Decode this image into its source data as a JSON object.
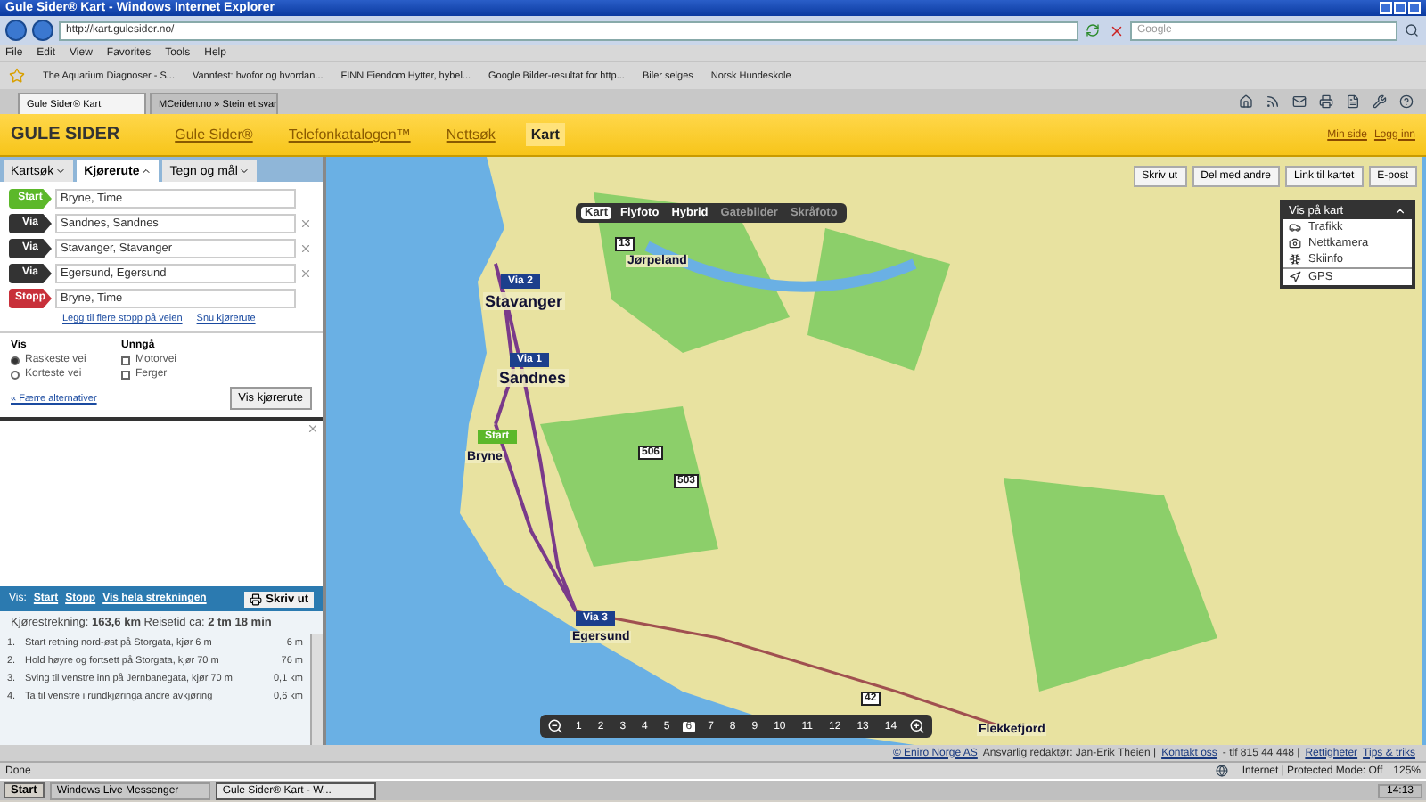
{
  "window": {
    "title": "Gule Sider® Kart - Windows Internet Explorer"
  },
  "address_bar": {
    "url": "http://kart.gulesider.no/",
    "search_placeholder": "Google"
  },
  "menu": [
    "File",
    "Edit",
    "View",
    "Favorites",
    "Tools",
    "Help"
  ],
  "favorites": [
    "The Aquarium Diagnoser - S...",
    "Vannfest: hvofor og hvordan...",
    "FINN Eiendom Hytter, hybel...",
    "Google Bilder-resultat for http...",
    "Biler selges",
    "Norsk Hundeskole"
  ],
  "browser_tabs": [
    {
      "label": "Gule Sider® Kart",
      "selected": true
    },
    {
      "label": "MCeiden.no » Stein et svar",
      "selected": false
    }
  ],
  "site_header": {
    "logo": "GULE SIDER",
    "nav": [
      {
        "label": "Gule Sider®",
        "selected": false
      },
      {
        "label": "Telefonkatalogen™",
        "selected": false
      },
      {
        "label": "Nettsøk",
        "selected": false
      },
      {
        "label": "Kart",
        "selected": true
      }
    ],
    "account": [
      "Min side",
      "Logg inn"
    ]
  },
  "panel_tabs": [
    {
      "label": "Kartsøk",
      "selected": false
    },
    {
      "label": "Kjørerute",
      "selected": true
    },
    {
      "label": "Tegn og mål",
      "selected": false
    }
  ],
  "route_points": [
    {
      "kind": "start",
      "tag": "Start",
      "value": "Bryne, Time"
    },
    {
      "kind": "via",
      "tag": "Via",
      "value": "Sandnes, Sandnes"
    },
    {
      "kind": "via",
      "tag": "Via",
      "value": "Stavanger, Stavanger"
    },
    {
      "kind": "via",
      "tag": "Via",
      "value": "Egersund, Egersund"
    },
    {
      "kind": "stop",
      "tag": "Stopp",
      "value": "Bryne, Time"
    }
  ],
  "route_links": [
    "Legg til flere stopp på veien",
    "Snu kjørerute"
  ],
  "options": {
    "show_title": "Vis",
    "show": [
      {
        "label": "Raskeste vei",
        "selected": true
      },
      {
        "label": "Korteste vei",
        "selected": false
      }
    ],
    "avoid_title": "Unngå",
    "avoid": [
      {
        "label": "Motorvei",
        "checked": false
      },
      {
        "label": "Ferger",
        "checked": false
      }
    ]
  },
  "fewer_link": "« Færre alternativer",
  "submit": "Vis kjørerute",
  "results_bar": {
    "label": "Vis:",
    "links": [
      "Start",
      "Stopp",
      "Vis hela strekningen"
    ],
    "print": "Skriv ut"
  },
  "summary": "Kjørestrekning: **163,6 km**  Reisetid ca: **2 tm 18 min**",
  "steps": [
    {
      "number": "1.",
      "text": "Start retning nord-øst på Storgata, kjør 6 m",
      "distance": "6 m"
    },
    {
      "number": "2.",
      "text": "Hold høyre og fortsett på Storgata, kjør 70 m",
      "distance": "76 m"
    },
    {
      "number": "3.",
      "text": "Sving til venstre inn på Jernbanegata, kjør 70 m",
      "distance": "0,1 km"
    },
    {
      "number": "4.",
      "text": "Ta til venstre i rundkjøringa andre avkjøring",
      "distance": "0,6 km"
    }
  ],
  "map_types": [
    {
      "label": "Kart",
      "selected": true,
      "disabled": false
    },
    {
      "label": "Flyfoto",
      "selected": false,
      "disabled": false
    },
    {
      "label": "Hybrid",
      "selected": false,
      "disabled": false
    },
    {
      "label": "Gatebilder",
      "selected": false,
      "disabled": true
    },
    {
      "label": "Skråfoto",
      "selected": false,
      "disabled": true
    }
  ],
  "map_actions": [
    "Skriv ut",
    "Del med andre",
    "Link til kartet",
    "E-post"
  ],
  "layers": {
    "title": "Vis på kart",
    "items": [
      {
        "kind": "traffic",
        "label": "Trafikk"
      },
      {
        "kind": "camera",
        "label": "Nettkamera"
      },
      {
        "kind": "ski",
        "label": "Skiinfo"
      },
      {
        "kind": "gps",
        "label": "GPS"
      }
    ]
  },
  "markers": [
    {
      "label": "Via 2"
    },
    {
      "label": "Via 1"
    },
    {
      "label": "Start"
    },
    {
      "label": "Via 3"
    }
  ],
  "places": [
    {
      "label": "Stavanger",
      "kind": "city"
    },
    {
      "label": "Sandnes",
      "kind": "city"
    },
    {
      "label": "Bryne",
      "kind": "town"
    },
    {
      "label": "Egersund",
      "kind": "town"
    },
    {
      "label": "Flekkefjord",
      "kind": "town"
    },
    {
      "label": "Jørpeland",
      "kind": "town"
    },
    {
      "label": "13",
      "kind": "road"
    },
    {
      "label": "506",
      "kind": "road"
    },
    {
      "label": "503",
      "kind": "road"
    },
    {
      "label": "42",
      "kind": "road"
    }
  ],
  "zoom_levels": [
    {
      "label": "1",
      "selected": false
    },
    {
      "label": "2",
      "selected": false
    },
    {
      "label": "3",
      "selected": false
    },
    {
      "label": "4",
      "selected": false
    },
    {
      "label": "5",
      "selected": false
    },
    {
      "label": "6",
      "selected": true
    },
    {
      "label": "7",
      "selected": false
    },
    {
      "label": "8",
      "selected": false
    },
    {
      "label": "9",
      "selected": false
    },
    {
      "label": "10",
      "selected": false
    },
    {
      "label": "11",
      "selected": false
    },
    {
      "label": "12",
      "selected": false
    },
    {
      "label": "13",
      "selected": false
    },
    {
      "label": "14",
      "selected": false
    }
  ],
  "footer": {
    "copyright": "© Eniro Norge AS",
    "text": "Ansvarlig redaktør: Jan-Erik Theien |",
    "links": [
      "Kontakt oss",
      "Rettigheter",
      "Tips & triks"
    ],
    "phone": "- tlf 815 44 448 |"
  },
  "status_bar": {
    "left": "Done",
    "zone": "Internet | Protected Mode: Off",
    "zoom": "125%"
  },
  "taskbar": {
    "start": "Start",
    "windows": [
      {
        "label": "Windows Live Messenger",
        "selected": false
      },
      {
        "label": "Gule Sider® Kart - W...",
        "selected": true
      }
    ],
    "clock": "14:13"
  }
}
